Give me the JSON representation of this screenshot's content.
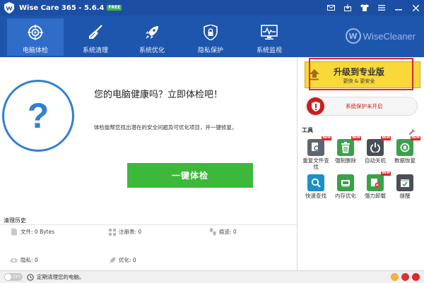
{
  "titlebar": {
    "title": "Wise Care 365 - 5.6.4",
    "badge": "FREE"
  },
  "nav": {
    "items": [
      {
        "label": "电脑体检",
        "icon": "target-icon",
        "active": true
      },
      {
        "label": "系统清理",
        "icon": "broom-icon"
      },
      {
        "label": "系统优化",
        "icon": "rocket-icon"
      },
      {
        "label": "隐私保护",
        "icon": "lock-shield-icon"
      },
      {
        "label": "系统监视",
        "icon": "monitor-icon"
      }
    ],
    "brand": "WiseCleaner"
  },
  "main": {
    "question_mark": "?",
    "title": "您的电脑健康吗？立即体检吧！",
    "description": "体检能帮您找出潜在的安全问题及可优化项目，并一键修复。",
    "check_button": "一键体检",
    "history_title": "清理历史",
    "stats": [
      {
        "label": "文件:",
        "value": "0 Bytes"
      },
      {
        "label": "注册表:",
        "value": "0"
      },
      {
        "label": "痕迹:",
        "value": "0"
      },
      {
        "label": "隐私:",
        "value": "0"
      },
      {
        "label": "优化:",
        "value": "0"
      }
    ]
  },
  "right": {
    "upgrade_main": "升级到专业版",
    "upgrade_sub": "更快 & 更安全",
    "protection_text": "系统保护未开启",
    "tools_title": "工具",
    "new_badge": "NEW",
    "tools": [
      {
        "label": "重复文件查找",
        "icon": "duplicate-file-icon",
        "color": "#5b6670",
        "new": true
      },
      {
        "label": "强制删除",
        "icon": "trash-icon",
        "color": "#3aa14a",
        "new": true
      },
      {
        "label": "自动关机",
        "icon": "power-icon",
        "color": "#4a4f55",
        "new": true
      },
      {
        "label": "数据恢复",
        "icon": "data-recovery-icon",
        "color": "#3aa14a",
        "new": true
      },
      {
        "label": "快速查找",
        "icon": "search-icon",
        "color": "#1c8ec9",
        "new": false
      },
      {
        "label": "内存优化",
        "icon": "memory-icon",
        "color": "#3aa14a",
        "new": false
      },
      {
        "label": "强力卸载",
        "icon": "uninstall-icon",
        "color": "#3aa14a",
        "new": true
      },
      {
        "label": "提醒",
        "icon": "calendar-check-icon",
        "color": "#4a4f55",
        "new": false
      }
    ]
  },
  "statusbar": {
    "toggle": "OFF",
    "text": "定期清理您的电脑。"
  },
  "colors": {
    "titlebar": "#1c4fa3",
    "navbar": "#1e56ad",
    "accent_green": "#3cb83b",
    "upgrade_yellow": "#f9d938",
    "alert_red": "#c81e20"
  }
}
